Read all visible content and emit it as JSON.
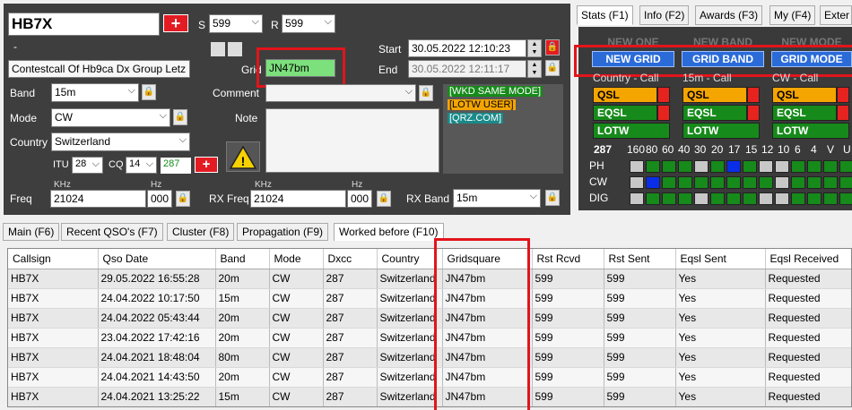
{
  "qso": {
    "callsign": "HB7X",
    "s_label": "S",
    "s_value": "599",
    "r_label": "R",
    "r_value": "599",
    "dash": "-",
    "name": "Contestcall Of Hb9ca Dx Group Letz",
    "grid_label": "Grid",
    "grid_value": "JN47bm",
    "start_label": "Start",
    "start_value": "30.05.2022 12:10:23",
    "end_label": "End",
    "end_value": "30.05.2022 12:11:17",
    "band_label": "Band",
    "band_value": "15m",
    "mode_label": "Mode",
    "mode_value": "CW",
    "country_label": "Country",
    "country_value": "Switzerland",
    "comment_label": "Comment",
    "note_label": "Note",
    "itu_label": "ITU",
    "itu_value": "28",
    "cq_label": "CQ",
    "cq_value": "14",
    "dxcc_value": "287",
    "khz_label": "KHz",
    "hz_label": "Hz",
    "freq_label": "Freq",
    "freq_khz": "21024",
    "freq_hz": "000",
    "rxfreq_label": "RX Freq",
    "rxfreq_khz": "21024",
    "rxfreq_hz": "000",
    "rxband_label": "RX Band",
    "rxband_value": "15m",
    "info_tags": [
      "[WKD SAME MODE]",
      "[LOTW USER]",
      "[QRZ.COM]"
    ]
  },
  "stats": {
    "tabs": [
      "Stats (F1)",
      "Info (F2)",
      "Awards (F3)",
      "My (F4)",
      "Exter"
    ],
    "faded": [
      "NEW ONE",
      "NEW BAND",
      "NEW MODE"
    ],
    "buttons": [
      "NEW GRID",
      "GRID BAND",
      "GRID MODE"
    ],
    "col_heads": [
      "Country - Call",
      "15m - Call",
      "CW - Call"
    ],
    "rows": [
      "QSL",
      "EQSL",
      "LOTW"
    ],
    "dxcc": "287",
    "bands": [
      "160",
      "80",
      "60",
      "40",
      "30",
      "20",
      "17",
      "15",
      "12",
      "10",
      "6",
      "4",
      "V",
      "U"
    ],
    "modes": [
      "PH",
      "CW",
      "DIG"
    ],
    "colors": {
      "green": "#168a1a",
      "blue": "#0a2ee8",
      "grey": "#c8c8c8",
      "qsl": "#f5a500",
      "red": "#e6231e"
    }
  },
  "bottom_tabs": [
    "Main (F6)",
    "Recent QSO's (F7)",
    "Cluster (F8)",
    "Propagation (F9)",
    "Worked before (F10)"
  ],
  "table": {
    "headers": [
      "Callsign",
      "Qso Date",
      "Band",
      "Mode",
      "Dxcc",
      "Country",
      "Gridsquare",
      "Rst Rcvd",
      "Rst Sent",
      "Eqsl Sent",
      "Eqsl Received"
    ],
    "rows": [
      [
        "HB7X",
        "29.05.2022 16:55:28",
        "20m",
        "CW",
        "287",
        "Switzerland",
        "JN47bm",
        "599",
        "599",
        "Yes",
        "Requested"
      ],
      [
        "HB7X",
        "24.04.2022 10:17:50",
        "15m",
        "CW",
        "287",
        "Switzerland",
        "JN47bm",
        "599",
        "599",
        "Yes",
        "Requested"
      ],
      [
        "HB7X",
        "24.04.2022 05:43:44",
        "20m",
        "CW",
        "287",
        "Switzerland",
        "JN47bm",
        "599",
        "599",
        "Yes",
        "Requested"
      ],
      [
        "HB7X",
        "23.04.2022 17:42:16",
        "20m",
        "CW",
        "287",
        "Switzerland",
        "JN47bm",
        "599",
        "599",
        "Yes",
        "Requested"
      ],
      [
        "HB7X",
        "24.04.2021 18:48:04",
        "80m",
        "CW",
        "287",
        "Switzerland",
        "JN47bm",
        "599",
        "599",
        "Yes",
        "Requested"
      ],
      [
        "HB7X",
        "24.04.2021 14:43:50",
        "20m",
        "CW",
        "287",
        "Switzerland",
        "JN47bm",
        "599",
        "599",
        "Yes",
        "Requested"
      ],
      [
        "HB7X",
        "24.04.2021 13:25:22",
        "15m",
        "CW",
        "287",
        "Switzerland",
        "JN47bm",
        "599",
        "599",
        "Yes",
        "Requested"
      ]
    ]
  }
}
